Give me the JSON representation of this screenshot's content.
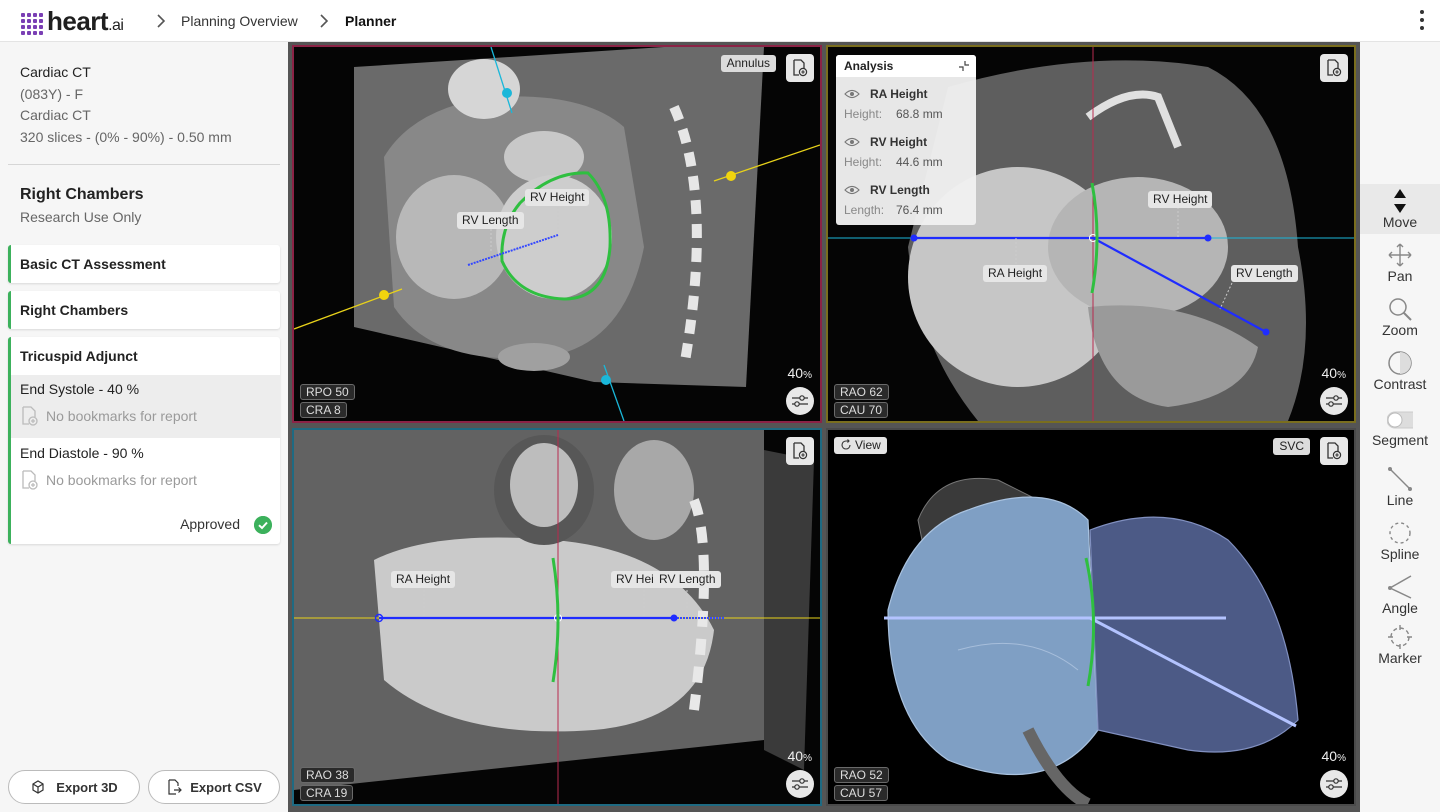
{
  "header": {
    "brand": "heart",
    "brand_suffix": ".ai",
    "breadcrumb": [
      "Planning Overview",
      "Planner"
    ]
  },
  "study": {
    "modality": "Cardiac CT",
    "patient": "(083Y) - F",
    "series": "Cardiac CT",
    "details": "320 slices - (0% - 90%) - 0.50 mm"
  },
  "section": {
    "title": "Right Chambers",
    "subtitle": "Research Use Only"
  },
  "steps": [
    {
      "label": "Basic CT Assessment"
    },
    {
      "label": "Right Chambers"
    },
    {
      "label": "Tricuspid Adjunct",
      "phases": [
        {
          "name": "End Systole - 40 %",
          "note": "No bookmarks for report"
        },
        {
          "name": "End Diastole - 90 %",
          "note": "No bookmarks for report"
        }
      ],
      "status": "Approved"
    }
  ],
  "buttons": {
    "export3d": "Export 3D",
    "exportcsv": "Export CSV"
  },
  "viewports": {
    "tl": {
      "tag": "Annulus",
      "angle1": "RPO 50",
      "angle2": "CRA   8",
      "zoom": "40",
      "zoom_unit": "%",
      "labels": {
        "rv_length": "RV Length",
        "rv_height": "RV Height"
      }
    },
    "tr": {
      "angle1": "RAO 62",
      "angle2": "CAU 70",
      "zoom": "40",
      "zoom_unit": "%",
      "labels": {
        "rv_height": "RV Height",
        "ra_height": "RA Height",
        "rv_length": "RV Length"
      }
    },
    "bl": {
      "angle1": "RAO 38",
      "angle2": "CRA 19",
      "zoom": "40",
      "zoom_unit": "%",
      "labels": {
        "ra_height": "RA Height",
        "rv_height": "RV Heig",
        "rv_length": "RV Length"
      }
    },
    "br": {
      "tag": "SVC",
      "view": "View",
      "angle1": "RAO 52",
      "angle2": "CAU 57",
      "zoom": "40",
      "zoom_unit": "%"
    }
  },
  "analysis": {
    "title": "Analysis",
    "items": [
      {
        "name": "RA Height",
        "label": "Height:",
        "value": "68.8 mm"
      },
      {
        "name": "RV Height",
        "label": "Height:",
        "value": "44.6 mm"
      },
      {
        "name": "RV Length",
        "label": "Length:",
        "value": "76.4 mm"
      }
    ]
  },
  "tools": [
    "Move",
    "Pan",
    "Zoom",
    "Contrast",
    "Segment",
    "Line",
    "Spline",
    "Angle",
    "Marker"
  ],
  "colors": {
    "accent_green": "#3cb15c",
    "measure_blue": "#1f3cff",
    "annulus_green": "#33c24a",
    "brand_purple": "#7a3fb4"
  }
}
